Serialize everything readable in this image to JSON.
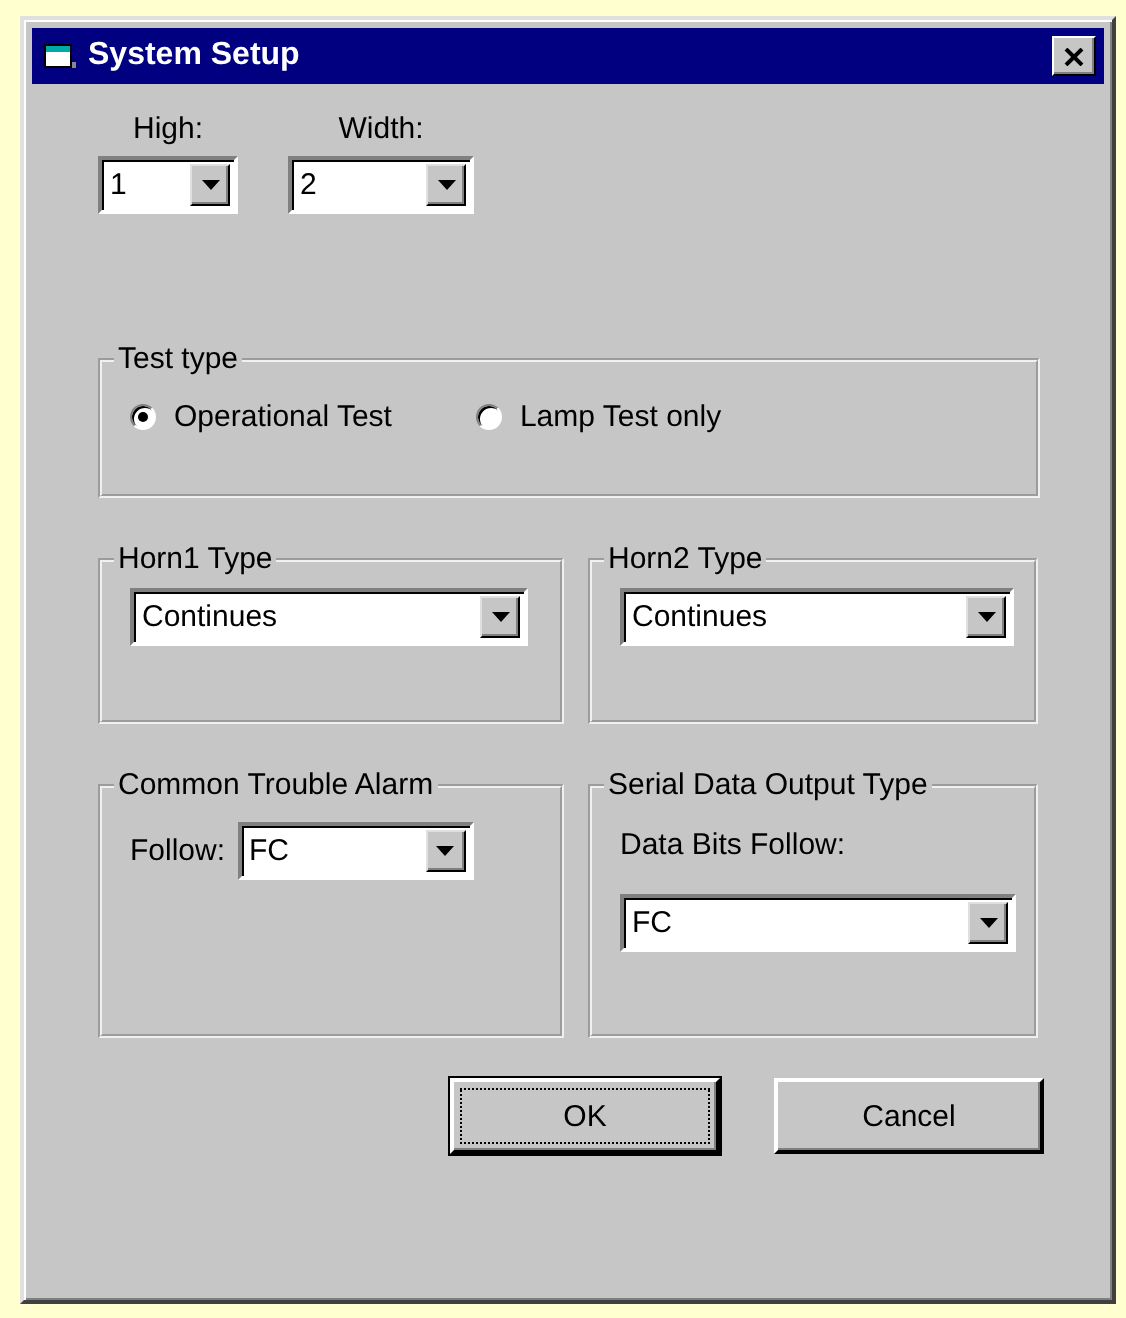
{
  "window": {
    "title": "System Setup"
  },
  "size_fields": [
    {
      "label": "High:",
      "value": "1"
    },
    {
      "label": "Width:",
      "value": "2"
    }
  ],
  "test_type": {
    "label": "Test type",
    "options": [
      {
        "label": "Operational Test",
        "selected": true
      },
      {
        "label": "Lamp Test only",
        "selected": false
      }
    ]
  },
  "horn_types": [
    {
      "label": "Horn1 Type",
      "value": "Continues"
    },
    {
      "label": "Horn2 Type",
      "value": "Continues"
    }
  ],
  "common_trouble_alarm": {
    "label": "Common Trouble Alarm",
    "field_label": "Follow:",
    "value": "FC"
  },
  "serial_data_output": {
    "label": "Serial Data Output Type",
    "field_label": "Data Bits Follow:",
    "value": "FC"
  },
  "buttons": [
    {
      "label": "OK",
      "default": true
    },
    {
      "label": "Cancel",
      "default": false
    }
  ]
}
